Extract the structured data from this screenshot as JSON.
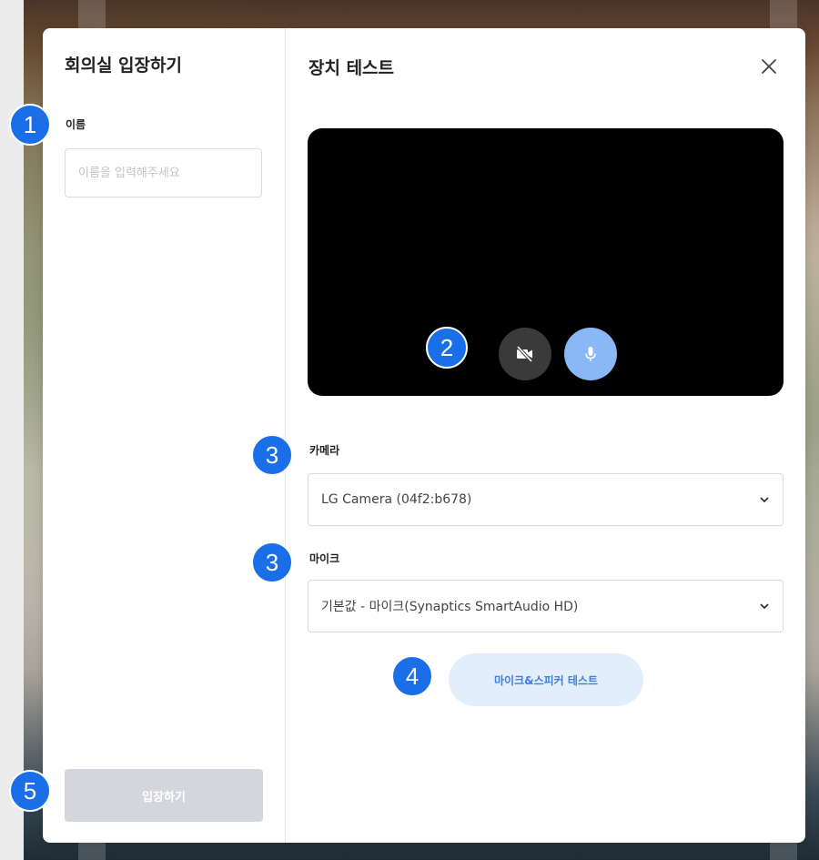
{
  "left": {
    "title": "회의실 입장하기",
    "name_label": "이름",
    "name_placeholder": "이름을 입력해주세요",
    "name_value": "",
    "enter_button": "입장하기"
  },
  "right": {
    "title": "장치 테스트",
    "camera_label": "카메라",
    "camera_selected": "LG Camera (04f2:b678)",
    "mic_label": "마이크",
    "mic_selected": "기본값 - 마이크(Synaptics SmartAudio HD)",
    "test_button": "마이크&스피커 테스트"
  },
  "icons": [
    "close-icon",
    "camera-off-icon",
    "microphone-icon",
    "chevron-down-icon"
  ],
  "badges": [
    "1",
    "2",
    "3",
    "3",
    "4",
    "5"
  ],
  "colors": {
    "accent": "#1a6fe8",
    "mic_button": "#8ab7f5",
    "test_button_bg": "#e3eefc",
    "test_button_text": "#3d7fe0",
    "disabled_button": "#d4d6db"
  }
}
